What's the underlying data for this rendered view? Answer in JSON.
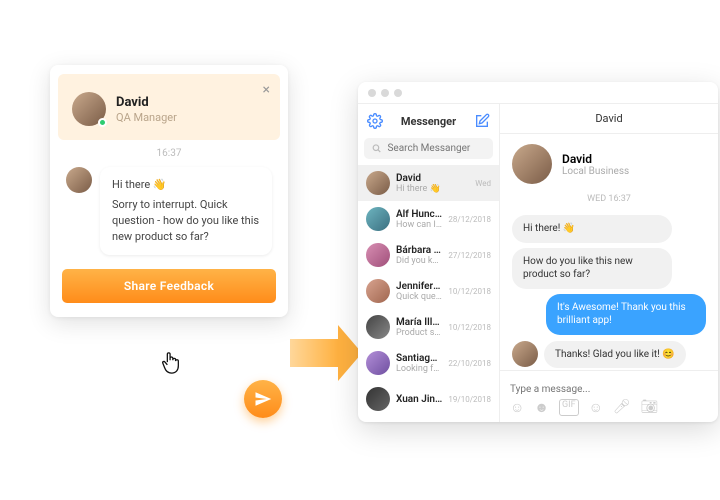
{
  "widget": {
    "name": "David",
    "role": "QA Manager",
    "time": "16:37",
    "hi": "Hi there 👋",
    "body": "Sorry to interrupt. Quick question - how do you like this new product so far?",
    "cta": "Share Feedback"
  },
  "messenger": {
    "title": "Messenger",
    "search_placeholder": "Search Messanger",
    "chat_title": "David",
    "chat_sub": "Local Business",
    "chat_date": "WED 16:37",
    "compose_placeholder": "Type a message...",
    "conversations": [
      {
        "name": "David",
        "preview": "Hi there 👋",
        "date": "Wed",
        "av": "av-1"
      },
      {
        "name": "Alf Huncoot",
        "preview": "How can I help you?",
        "date": "28/12/2018",
        "av": "av-2"
      },
      {
        "name": "Bárbara Co...",
        "preview": "Did you know that...",
        "date": "27/12/2018",
        "av": "av-3"
      },
      {
        "name": "Jennifer Re...",
        "preview": "Quick question - how",
        "date": "10/12/2018",
        "av": "av-5"
      },
      {
        "name": "María Illes...",
        "preview": "Product so far...",
        "date": "10/12/2018",
        "av": "av-6"
      },
      {
        "name": "Santiago...",
        "preview": "Looking for a place...",
        "date": "22/10/2018",
        "av": "av-7"
      },
      {
        "name": "Xuan Jingyi",
        "preview": "",
        "date": "19/10/2018",
        "av": "av-8"
      }
    ],
    "messages": {
      "in1": "Hi there! 👋",
      "in2": "How do you like this new product so far?",
      "out1": "It's Awesome! Thank you this brilliant app!",
      "in3": "Thanks! Glad you like it! 😊"
    }
  }
}
